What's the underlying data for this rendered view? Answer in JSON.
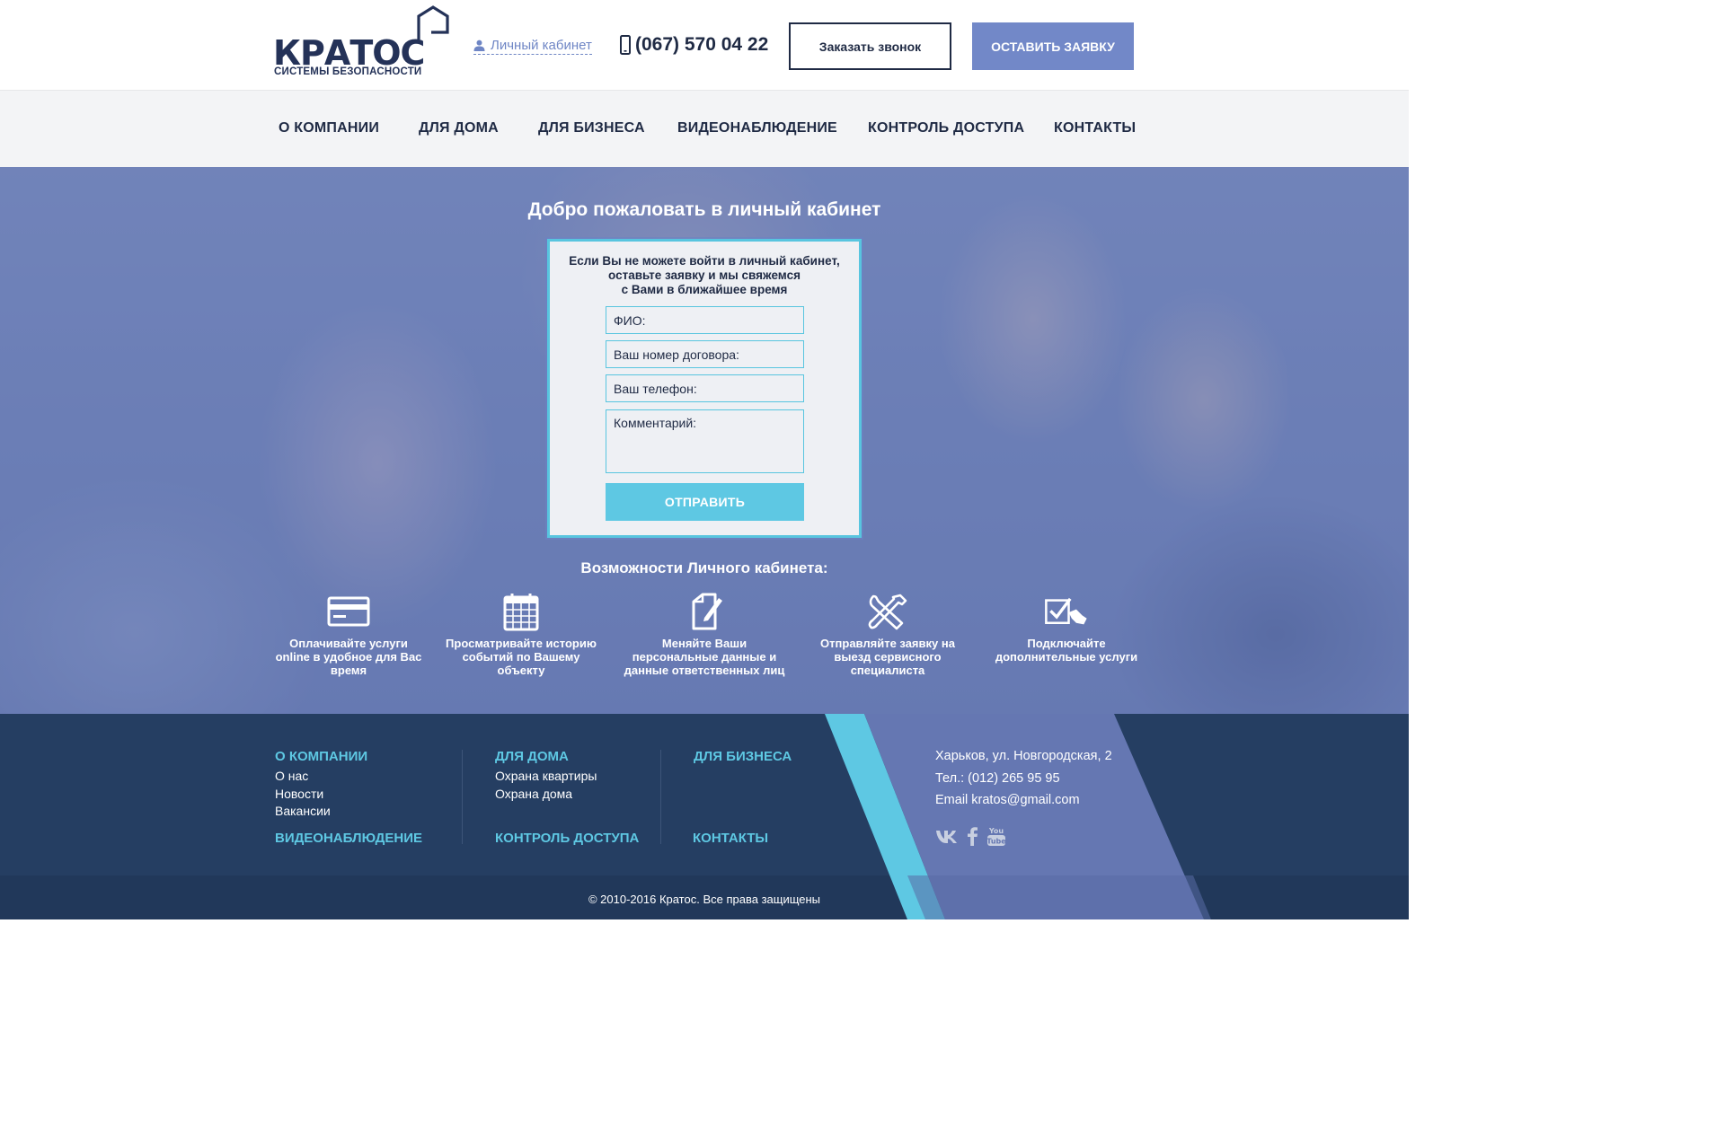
{
  "header": {
    "logo_text": "КРАТОС",
    "logo_subtitle": "СИСТЕМЫ БЕЗОПАСНОСТИ",
    "cabinet_link": "Личный кабинет",
    "phone": "(067) 570 04 22",
    "call_button": "Заказать звонок",
    "request_button": "ОСТАВИТЬ ЗАЯВКУ"
  },
  "nav": {
    "items": [
      {
        "label": "О КОМПАНИИ"
      },
      {
        "label": "ДЛЯ ДОМА"
      },
      {
        "label": "ДЛЯ БИЗНЕСА"
      },
      {
        "label": "ВИДЕОНАБЛЮДЕНИЕ"
      },
      {
        "label": "КОНТРОЛЬ ДОСТУПА"
      },
      {
        "label": "КОНТАКТЫ"
      }
    ]
  },
  "hero": {
    "title": "Добро пожаловать в личный кабинет",
    "form": {
      "intro_lines": [
        "Если Вы не можете войти в личный кабинет,",
        "оставьте заявку и мы свяжемся",
        "с Вами в ближайшее время"
      ],
      "name_placeholder": "ФИО:",
      "contract_placeholder": "Ваш номер договора:",
      "phone_placeholder": "Ваш телефон:",
      "comment_placeholder": "Комментарий:",
      "submit_label": "ОТПРАВИТЬ"
    },
    "features_title": "Возможности Личного кабинета:",
    "features": [
      {
        "icon": "credit-card-icon",
        "lines": [
          "Оплачивайте услуги",
          "online в удобное для Вас",
          "время"
        ]
      },
      {
        "icon": "calendar-icon",
        "lines": [
          "Просматривайте историю",
          "событий по Вашему",
          "объекту"
        ]
      },
      {
        "icon": "edit-document-icon",
        "lines": [
          "Меняйте Ваши",
          "персональные данные и",
          "данные ответственных лиц"
        ]
      },
      {
        "icon": "tools-icon",
        "lines": [
          "Отправляйте заявку на",
          "выезд сервисного",
          "специалиста"
        ]
      },
      {
        "icon": "checkbox-hand-icon",
        "lines": [
          "Подключайте",
          "дополнительные услуги"
        ]
      }
    ]
  },
  "footer": {
    "col1": {
      "title": "О КОМПАНИИ",
      "links": [
        "О нас",
        "Новости",
        "Вакансии"
      ],
      "bottom": "ВИДЕОНАБЛЮДЕНИЕ"
    },
    "col2": {
      "title": "ДЛЯ ДОМА",
      "links": [
        "Охрана квартиры",
        "Охрана дома"
      ],
      "bottom": "КОНТРОЛЬ ДОСТУПА"
    },
    "col3": {
      "title": "ДЛЯ БИЗНЕСА",
      "bottom": "КОНТАКТЫ"
    },
    "contact": {
      "address": "Харьков, ул. Новгородская, 2",
      "phone": "Тел.: (012) 265 95 95",
      "email": "Email  kratos@gmail.com"
    },
    "socials": [
      "vk-icon",
      "facebook-icon",
      "youtube-icon"
    ],
    "copyright": "© 2010-2016 Кратос. Все права защищены"
  },
  "colors": {
    "brand_dark": "#243258",
    "accent_blue": "#7288c8",
    "accent_cyan": "#5ec8e3",
    "footer_bg": "#253e62"
  }
}
